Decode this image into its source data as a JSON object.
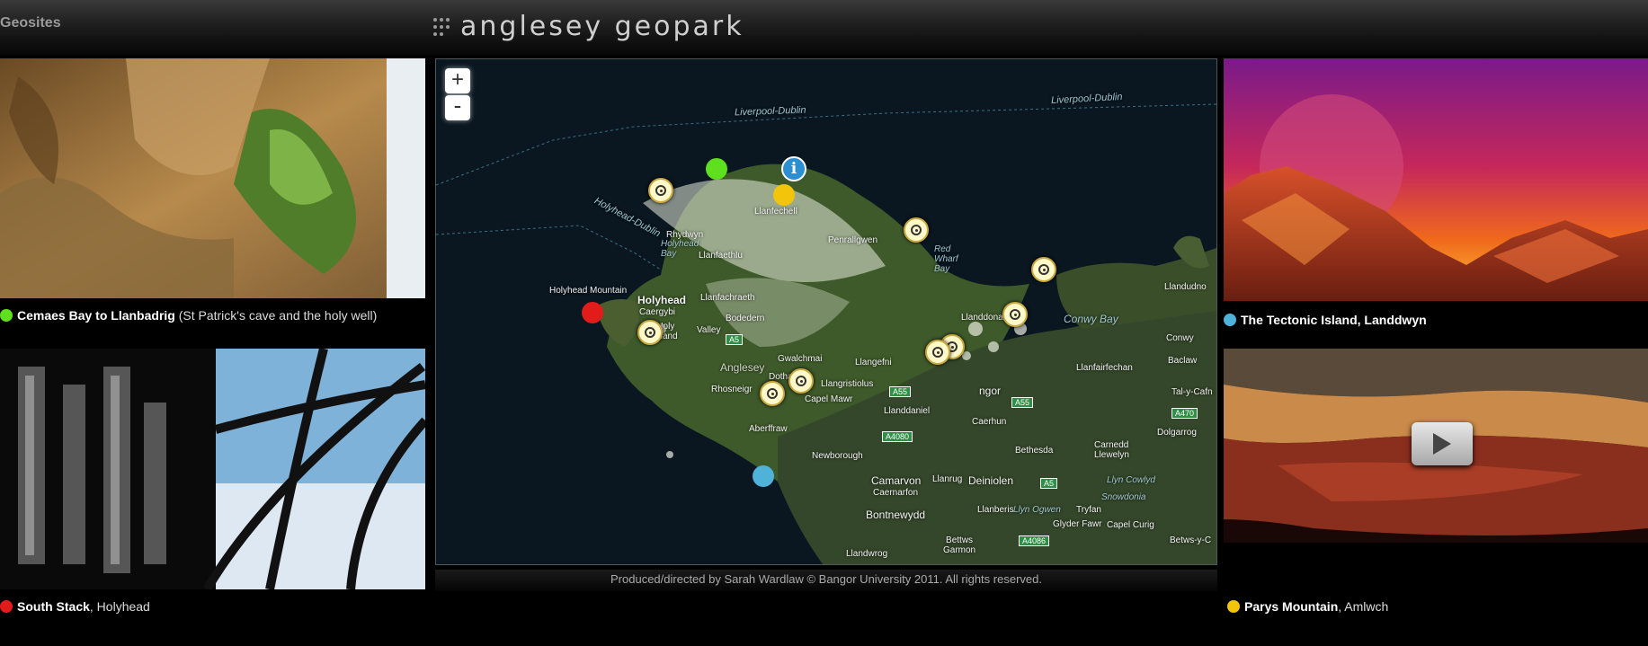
{
  "header": {
    "section_label": "Geosites",
    "brand_title": "anglesey geopark"
  },
  "tiles": [
    {
      "id": "cemaes",
      "title": "Cemaes Bay to Llanbadrig",
      "subtitle": " (St Patrick's cave and the holy well)",
      "color": "#5ee01e"
    },
    {
      "id": "southstack",
      "title": "South Stack",
      "subtitle": ", Holyhead",
      "color": "#e21b1b"
    },
    {
      "id": "tectonic",
      "title": "The  Tectonic Island, Landdwyn",
      "subtitle": "",
      "color": "#4fb3d9"
    },
    {
      "id": "parys",
      "title": "Parys Mountain",
      "subtitle": ", Amlwch",
      "color": "#f2c40c"
    }
  ],
  "map": {
    "zoom_in": "+",
    "zoom_out": "-",
    "info_icon": "i",
    "labels": {
      "liverpool1": "Liverpool-Dublin",
      "liverpool2": "Liverpool-Dublin",
      "holyhead_dublin": "Holyhead-Dublin",
      "holyhead_mountain": "Holyhead Mountain",
      "holyhead": "Holyhead",
      "caergybi": "Caergybi",
      "holy_island": "Holy\nIsland",
      "holyhead_bay": "Holyhead\nBay",
      "red_wharf_bay": "Red\nWharf\nBay",
      "conwy_bay": "Conwy Bay",
      "anglesey": "Anglesey",
      "llandudno": "Llandudno",
      "conwy": "Conwy",
      "caernarfon": "Caernarfon",
      "camarvon": "Camarvon",
      "deiniolen": "Deiniolen",
      "bontnewydd": "Bontnewydd",
      "newborough": "Newborough",
      "rhydwyn": "Rhydwyn",
      "llanfaethlu": "Llanfaethlu",
      "llanfachraeth": "Llanfachraeth",
      "bodedern": "Bodedern",
      "valley": "Valley",
      "gwalchmai": "Gwalchmai",
      "llangristiolus": "Llangristiolus",
      "llangefni": "Llangefni",
      "llanddona": "Llanddona",
      "capel_mawr": "Capel Mawr",
      "aberffraw": "Aberffraw",
      "rhosneigr": "Rhosneigr",
      "bethesda": "Bethesda",
      "llanfairfechan": "Llanfairfechan",
      "snowdonia": "Snowdonia",
      "llyn_cowlyd": "Llyn Cowlyd",
      "llyn_ogwen": "Llyn Ogwen",
      "glyder_fawr": "Glyder Fawr",
      "capel_curig": "Capel Curig",
      "tryfan": "Tryfan",
      "betws": "Betws-y-C",
      "llandwrog": "Llandwrog",
      "dolgarrog": "Dolgarrog",
      "baclaw": "Baclaw",
      "tal_y_cafn": "Tal-y-Cafn",
      "carnedd": "Carnedd\nLlewelyn",
      "llanberis": "Llanberis",
      "llanrug": "Llanrug",
      "bettws_garmon": "Bettws\nGarmon",
      "llanfechell": "Llanfechell",
      "penrhyndeudraeth": "Penrallgwen",
      "llanddaniel": "Llanddaniel",
      "dothan": "Dothan",
      "caerhun": "Caerhun",
      "bangor": "ngor"
    },
    "roads": [
      "A5",
      "A55",
      "A55",
      "A4080",
      "A470",
      "A5",
      "A4086"
    ]
  },
  "credit": "Produced/directed by Sarah Wardlaw © Bangor University 2011. All rights reserved.",
  "play_icon": "play-icon",
  "colors": {
    "accent_green": "#5ee01e",
    "accent_red": "#e21b1b",
    "accent_cyan": "#4fb3d9",
    "accent_yellow": "#f2c40c"
  }
}
